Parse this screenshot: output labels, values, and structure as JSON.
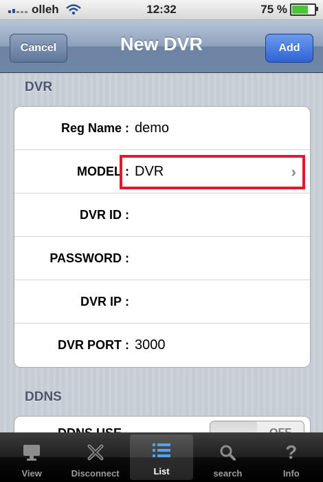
{
  "status": {
    "carrier": "olleh",
    "time": "12:32",
    "battery_text": "75 %",
    "battery_level": 0.75
  },
  "nav": {
    "title": "New DVR",
    "cancel_label": "Cancel",
    "add_label": "Add"
  },
  "dvr_section": {
    "title": "DVR",
    "rows": [
      {
        "label": "Reg Name",
        "value": "demo"
      },
      {
        "label": "MODEL",
        "value": "DVR"
      },
      {
        "label": "DVR ID",
        "value": ""
      },
      {
        "label": "PASSWORD",
        "value": ""
      },
      {
        "label": "DVR IP",
        "value": ""
      },
      {
        "label": "DVR PORT",
        "value": "3000"
      }
    ]
  },
  "ddns_section": {
    "title": "DDNS",
    "row_label": "DDNS USE",
    "toggle_off_label": "OFF"
  },
  "tabs": [
    {
      "label": "View",
      "icon": "monitor-icon"
    },
    {
      "label": "Disconnect",
      "icon": "x-icon"
    },
    {
      "label": "List",
      "icon": "list-icon"
    },
    {
      "label": "search",
      "icon": "search-icon"
    },
    {
      "label": "Info",
      "icon": "question-icon"
    }
  ],
  "colors": {
    "highlight": "#e0182b",
    "add_button": "#2f63d4"
  }
}
